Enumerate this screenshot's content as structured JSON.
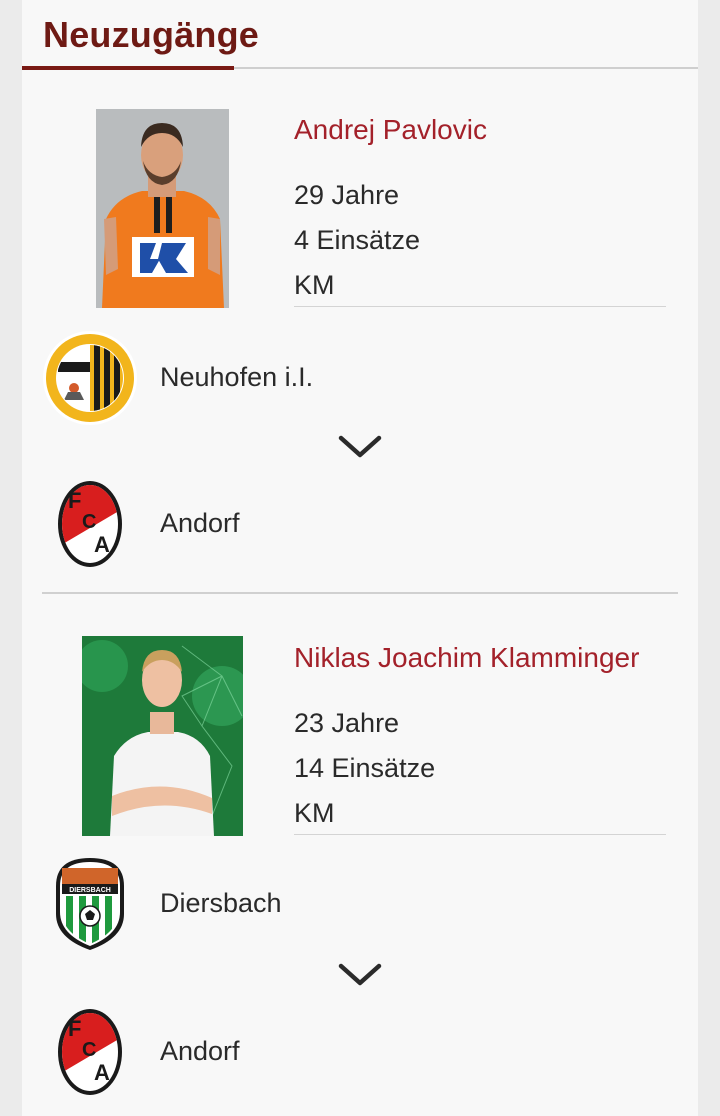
{
  "section": {
    "title": "Neuzugänge"
  },
  "players": [
    {
      "name": "Andrej Pavlovic",
      "age": "29 Jahre",
      "appearances": "4 Einsätze",
      "league": "KM",
      "from_club": "Neuhofen i.I.",
      "to_club": "Andorf"
    },
    {
      "name": "Niklas Joachim Klamminger",
      "age": "23 Jahre",
      "appearances": "14 Einsätze",
      "league": "KM",
      "from_club": "Diersbach",
      "to_club": "Andorf"
    }
  ],
  "icons": {
    "transfer_arrow": "chevron-down-icon"
  },
  "colors": {
    "title": "#6e1a14",
    "accent_line": "#7a1a14",
    "player_name": "#a3212a",
    "text": "#2a2a2a",
    "background": "#f8f8f8"
  }
}
